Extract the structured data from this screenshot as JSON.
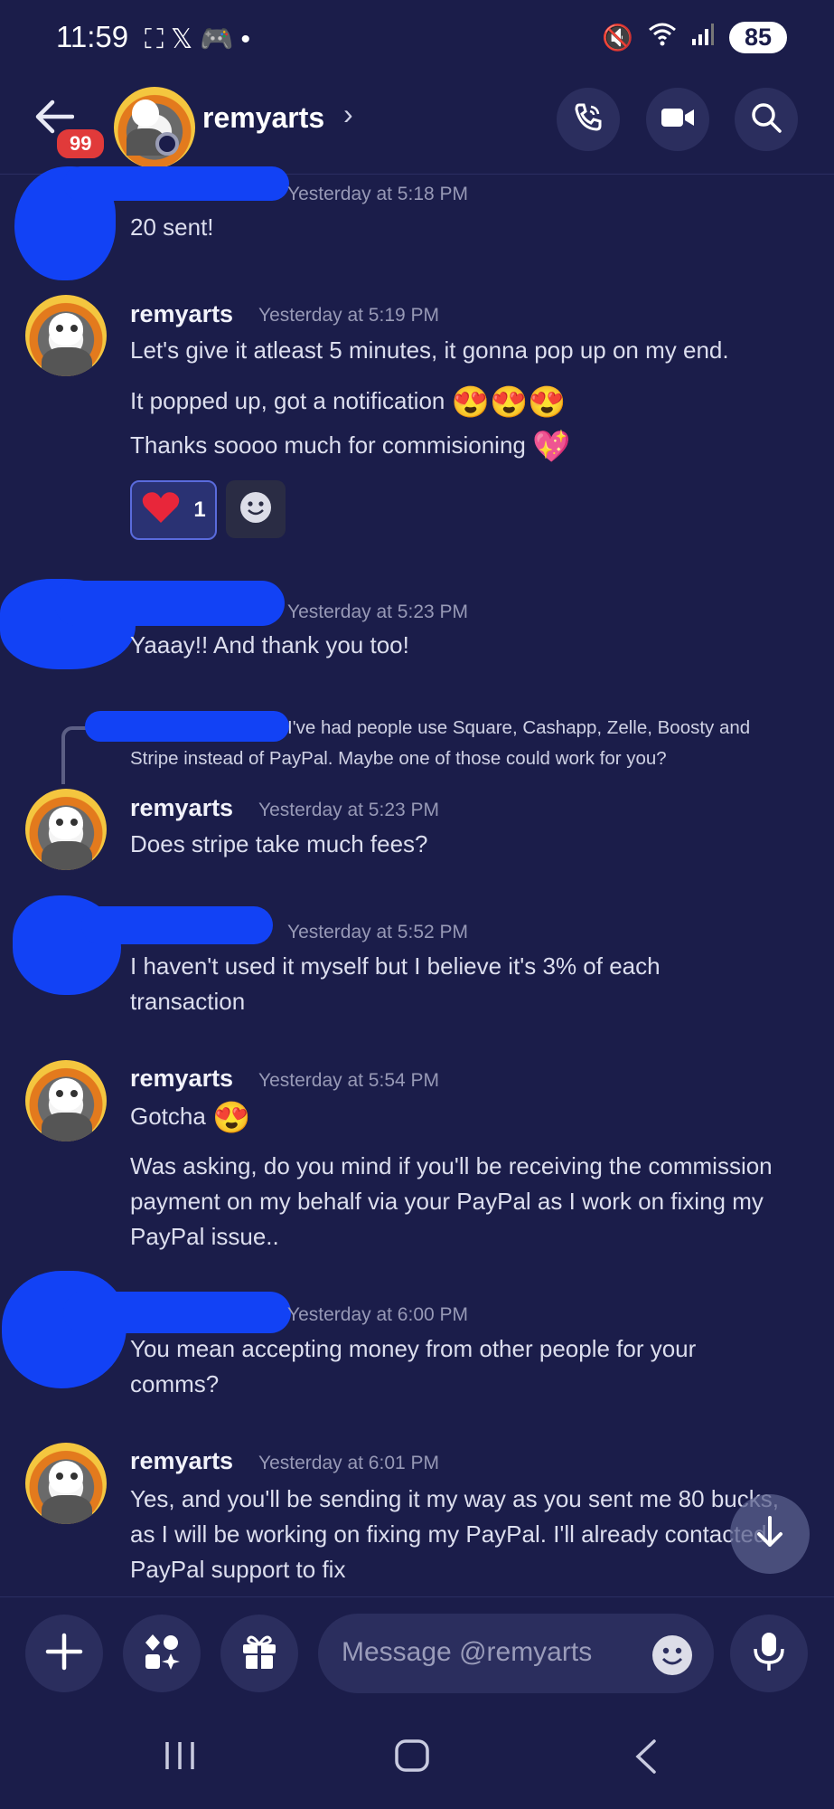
{
  "status_bar": {
    "time": "11:59",
    "battery": "85"
  },
  "header": {
    "badge": "99",
    "title": "remyarts",
    "chevron": "›"
  },
  "messages": [
    {
      "ts": "Yesterday at 5:18 PM",
      "lines": [
        "20 sent!"
      ]
    },
    {
      "user": "remyarts",
      "ts": "Yesterday at 5:19 PM",
      "lines": [
        "Let's give it atleast 5 minutes, it gonna pop up on my end.",
        "It popped up, got a notification",
        "Thanks soooo much for commisioning"
      ],
      "emoji_line2": "😍😍😍",
      "emoji_line3": "💖",
      "reaction_count": "1"
    },
    {
      "ts": "Yesterday at 5:23 PM",
      "lines": [
        "Yaaay!! And thank you too!"
      ]
    },
    {
      "reply_preview": "I've had people use Square, Cashapp, Zelle, Boosty and",
      "reply_preview2": "Stripe instead of PayPal. Maybe one of those could work for you?",
      "user": "remyarts",
      "ts": "Yesterday at 5:23 PM",
      "lines": [
        "Does stripe take much fees?"
      ]
    },
    {
      "ts": "Yesterday at 5:52 PM",
      "lines": [
        "I haven't used it myself but I believe it's 3% of each",
        "transaction"
      ]
    },
    {
      "user": "remyarts",
      "ts": "Yesterday at 5:54 PM",
      "lines": [
        "Gotcha",
        "Was asking, do you mind if you'll be receiving the commission",
        "payment on my behalf via your PayPal as I work on fixing my",
        "PayPal issue.."
      ],
      "emoji_line1": "😍"
    },
    {
      "ts": "Yesterday at 6:00 PM",
      "lines": [
        "You mean accepting money from other people for your",
        "comms?"
      ]
    },
    {
      "user": "remyarts",
      "ts": "Yesterday at 6:01 PM",
      "lines": [
        "Yes, and you'll be sending it my way as you sent me 80 bucks,",
        "as I will be working on fixing my PayPal. I'll already contacted",
        "PayPal support to fix"
      ]
    }
  ],
  "composer": {
    "placeholder": "Message @remyarts"
  },
  "icons": {
    "back": "arrow-left-icon",
    "call": "phone-icon",
    "video": "video-camera-icon",
    "search": "search-icon",
    "add": "plus-icon",
    "apps": "apps-icon",
    "gift": "gift-icon",
    "emoji": "emoji-icon",
    "mic": "microphone-icon",
    "recents": "recents-icon",
    "home": "home-icon",
    "nav_back": "nav-back-icon",
    "scroll_down": "arrow-down-icon"
  },
  "colors": {
    "background": "#1b1d4a",
    "accent_reaction": "#2a3273",
    "badge": "#e13a3a",
    "blur_blob": "#1242f5"
  }
}
